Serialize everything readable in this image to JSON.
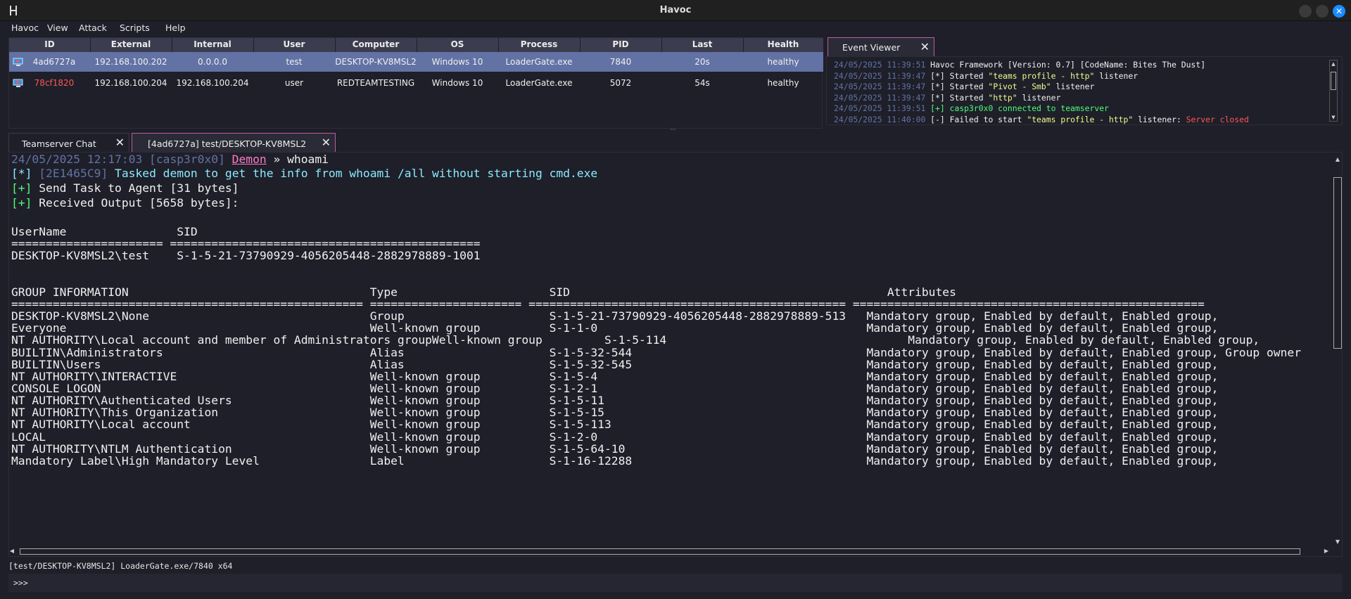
{
  "window": {
    "title": "Havoc"
  },
  "menu": [
    "Havoc",
    "View",
    "Attack",
    "Scripts",
    "Help"
  ],
  "sessions": {
    "columns": [
      "ID",
      "External",
      "Internal",
      "User",
      "Computer",
      "OS",
      "Process",
      "PID",
      "Last",
      "Health"
    ],
    "rows": [
      {
        "id": "4ad6727a",
        "external": "192.168.100.202",
        "internal": "0.0.0.0",
        "user": "test",
        "computer": "DESKTOP-KV8MSL2",
        "os": "Windows 10",
        "process": "LoaderGate.exe",
        "pid": "7840",
        "last": "20s",
        "health": "healthy",
        "selected": true
      },
      {
        "id": "78cf1820",
        "external": "192.168.100.204",
        "internal": "192.168.100.204",
        "user": "user",
        "computer": "REDTEAMTESTING",
        "os": "Windows 10",
        "process": "LoaderGate.exe",
        "pid": "5072",
        "last": "54s",
        "health": "healthy",
        "selected": false
      }
    ]
  },
  "event_viewer": {
    "tab_label": "Event Viewer",
    "lines": [
      {
        "ts": "24/05/2025 11:39:51",
        "parts": [
          {
            "t": "Havoc Framework [Version: 0.7] [CodeName: Bites The Dust]",
            "c": ""
          }
        ]
      },
      {
        "ts": "24/05/2025 11:39:47",
        "parts": [
          {
            "t": "[*]",
            "c": "ev-tag"
          },
          {
            "t": " Started ",
            "c": ""
          },
          {
            "t": "\"teams profile - http\"",
            "c": "ev-str"
          },
          {
            "t": " listener",
            "c": ""
          }
        ]
      },
      {
        "ts": "24/05/2025 11:39:47",
        "parts": [
          {
            "t": "[*]",
            "c": "ev-tag"
          },
          {
            "t": " Started ",
            "c": ""
          },
          {
            "t": "\"Pivot - Smb\"",
            "c": "ev-str"
          },
          {
            "t": " listener",
            "c": ""
          }
        ]
      },
      {
        "ts": "24/05/2025 11:39:47",
        "parts": [
          {
            "t": "[*]",
            "c": "ev-tag"
          },
          {
            "t": " Started ",
            "c": ""
          },
          {
            "t": "\"http\"",
            "c": "ev-str"
          },
          {
            "t": " listener",
            "c": ""
          }
        ]
      },
      {
        "ts": "24/05/2025 11:39:51",
        "parts": [
          {
            "t": "[+]",
            "c": "ev-tag ok"
          },
          {
            "t": " casp3r0x0 connected to teamserver",
            "c": "ev-green"
          }
        ]
      },
      {
        "ts": "24/05/2025 11:40:00",
        "parts": [
          {
            "t": "[-]",
            "c": "ev-tag"
          },
          {
            "t": " Failed to start ",
            "c": ""
          },
          {
            "t": "\"teams profile - http\"",
            "c": "ev-str"
          },
          {
            "t": " listener: ",
            "c": ""
          },
          {
            "t": "Server closed",
            "c": "ev-red"
          }
        ]
      }
    ]
  },
  "tabs": [
    {
      "label": "Teamserver Chat",
      "active": false
    },
    {
      "label": "[4ad6727a] test/DESKTOP-KV8MSL2",
      "active": true
    }
  ],
  "console": {
    "header": {
      "ts": "24/05/2025 12:17:03 [casp3r0x0] ",
      "demon": "Demon",
      "sep": " » ",
      "cmd": "whoami"
    },
    "task": {
      "tag": "[*]",
      "task_id": " [2E1465C9]",
      "text": " Tasked demon to get the info from whoami /all without starting cmd.exe"
    },
    "sent": {
      "tag": "[+]",
      "text": " Send Task to Agent [31 bytes]"
    },
    "received": {
      "tag": "[+]",
      "text": " Received Output [5658 bytes]:"
    },
    "output_lines": [
      "UserName                SID",
      "====================== =============================================",
      "DESKTOP-KV8MSL2\\test    S-1-5-21-73790929-4056205448-2882978889-1001",
      "",
      "",
      "GROUP INFORMATION                                   Type                      SID                                              Attributes",
      "=================================================== ====================== ============================================== ===================================================",
      "DESKTOP-KV8MSL2\\None                                Group                     S-1-5-21-73790929-4056205448-2882978889-513   Mandatory group, Enabled by default, Enabled group,",
      "Everyone                                            Well-known group          S-1-1-0                                       Mandatory group, Enabled by default, Enabled group,",
      "NT AUTHORITY\\Local account and member of Administrators groupWell-known group         S-1-5-114                                   Mandatory group, Enabled by default, Enabled group,",
      "BUILTIN\\Administrators                              Alias                     S-1-5-32-544                                  Mandatory group, Enabled by default, Enabled group, Group owner",
      "BUILTIN\\Users                                       Alias                     S-1-5-32-545                                  Mandatory group, Enabled by default, Enabled group,",
      "NT AUTHORITY\\INTERACTIVE                            Well-known group          S-1-5-4                                       Mandatory group, Enabled by default, Enabled group,",
      "CONSOLE LOGON                                       Well-known group          S-1-2-1                                       Mandatory group, Enabled by default, Enabled group,",
      "NT AUTHORITY\\Authenticated Users                    Well-known group          S-1-5-11                                      Mandatory group, Enabled by default, Enabled group,",
      "NT AUTHORITY\\This Organization                      Well-known group          S-1-5-15                                      Mandatory group, Enabled by default, Enabled group,",
      "NT AUTHORITY\\Local account                          Well-known group          S-1-5-113                                     Mandatory group, Enabled by default, Enabled group,",
      "LOCAL                                               Well-known group          S-1-2-0                                       Mandatory group, Enabled by default, Enabled group,",
      "NT AUTHORITY\\NTLM Authentication                    Well-known group          S-1-5-64-10                                   Mandatory group, Enabled by default, Enabled group,",
      "Mandatory Label\\High Mandatory Level                Label                     S-1-16-12288                                  Mandatory group, Enabled by default, Enabled group,"
    ]
  },
  "status_bar": {
    "text": "[test/DESKTOP-KV8MSL2] LoaderGate.exe/7840 x64"
  },
  "input": {
    "prompt": ">>>",
    "value": ""
  },
  "icons": {
    "app": "havoc-logo-icon",
    "session": "computer-icon",
    "close": "close-icon"
  },
  "colors": {
    "background": "#1e1f29",
    "header": "#3b3d4e",
    "selected_row": "#6272a4",
    "accent_tab": "#bd5d9e",
    "green": "#50fa7b",
    "cyan": "#8be9fd",
    "pink": "#ff79c6",
    "red": "#ff5555",
    "yellow": "#f1fa8c"
  }
}
